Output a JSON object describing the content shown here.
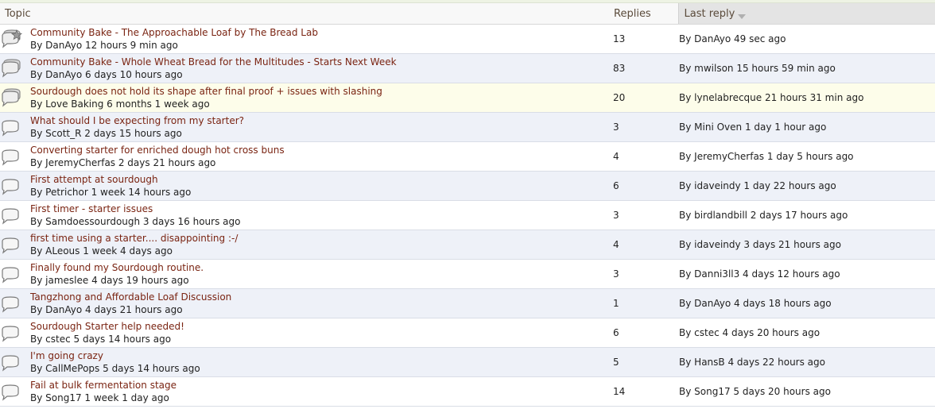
{
  "header": {
    "topic": "Topic",
    "replies": "Replies",
    "last_reply": "Last reply"
  },
  "topics": [
    {
      "title": "Community Bake - The Approachable Loaf by The Bread Lab",
      "by": "By DanAyo 12 hours 9 min ago",
      "replies": "13",
      "last": "By DanAyo 49 sec ago",
      "icon": "sticky-speech-bubble-icon",
      "style": "odd"
    },
    {
      "title": "Community Bake - Whole Wheat Bread for the Multitudes - Starts Next Week",
      "by": "By DanAyo 6 days 10 hours ago",
      "replies": "83",
      "last": "By mwilson 15 hours 59 min ago",
      "icon": "hot-speech-bubble-icon",
      "style": "even"
    },
    {
      "title": "Sourdough does not hold its shape after final proof + issues with slashing",
      "by": "By Love Baking 6 months 1 week ago",
      "replies": "20",
      "last": "By lynelabrecque 21 hours 31 min ago",
      "icon": "hot-speech-bubble-icon",
      "style": "hot"
    },
    {
      "title": "What should I be expecting from my starter?",
      "by": "By Scott_R 2 days 15 hours ago",
      "replies": "3",
      "last": "By Mini Oven 1 day 1 hour ago",
      "icon": "speech-bubble-icon",
      "style": "even"
    },
    {
      "title": "Converting starter for enriched dough hot cross buns",
      "by": "By JeremyCherfas 2 days 21 hours ago",
      "replies": "4",
      "last": "By JeremyCherfas 1 day 5 hours ago",
      "icon": "speech-bubble-icon",
      "style": "odd"
    },
    {
      "title": "First attempt at sourdough",
      "by": "By Petrichor 1 week 14 hours ago",
      "replies": "6",
      "last": "By idaveindy 1 day 22 hours ago",
      "icon": "speech-bubble-icon",
      "style": "even"
    },
    {
      "title": "First timer - starter issues",
      "by": "By Samdoessourdough 3 days 16 hours ago",
      "replies": "3",
      "last": "By birdlandbill 2 days 17 hours ago",
      "icon": "speech-bubble-icon",
      "style": "odd"
    },
    {
      "title": "first time using a starter.... disappointing :-/",
      "by": "By ALeous 1 week 4 days ago",
      "replies": "4",
      "last": "By idaveindy 3 days 21 hours ago",
      "icon": "speech-bubble-icon",
      "style": "even"
    },
    {
      "title": "Finally found my Sourdough routine.",
      "by": "By jameslee 4 days 19 hours ago",
      "replies": "3",
      "last": "By Danni3ll3 4 days 12 hours ago",
      "icon": "speech-bubble-icon",
      "style": "odd"
    },
    {
      "title": "Tangzhong and Affordable Loaf Discussion",
      "by": "By DanAyo 4 days 21 hours ago",
      "replies": "1",
      "last": "By DanAyo 4 days 18 hours ago",
      "icon": "speech-bubble-icon",
      "style": "even"
    },
    {
      "title": "Sourdough Starter help needed!",
      "by": "By cstec 5 days 14 hours ago",
      "replies": "6",
      "last": "By cstec 4 days 20 hours ago",
      "icon": "speech-bubble-icon",
      "style": "odd"
    },
    {
      "title": "I'm going crazy",
      "by": "By CallMePops 5 days 14 hours ago",
      "replies": "5",
      "last": "By HansB 4 days 22 hours ago",
      "icon": "speech-bubble-icon",
      "style": "even"
    },
    {
      "title": "Fail at bulk fermentation stage",
      "by": "By Song17 1 week 1 day ago",
      "replies": "14",
      "last": "By Song17 5 days 20 hours ago",
      "icon": "speech-bubble-icon",
      "style": "odd"
    }
  ]
}
